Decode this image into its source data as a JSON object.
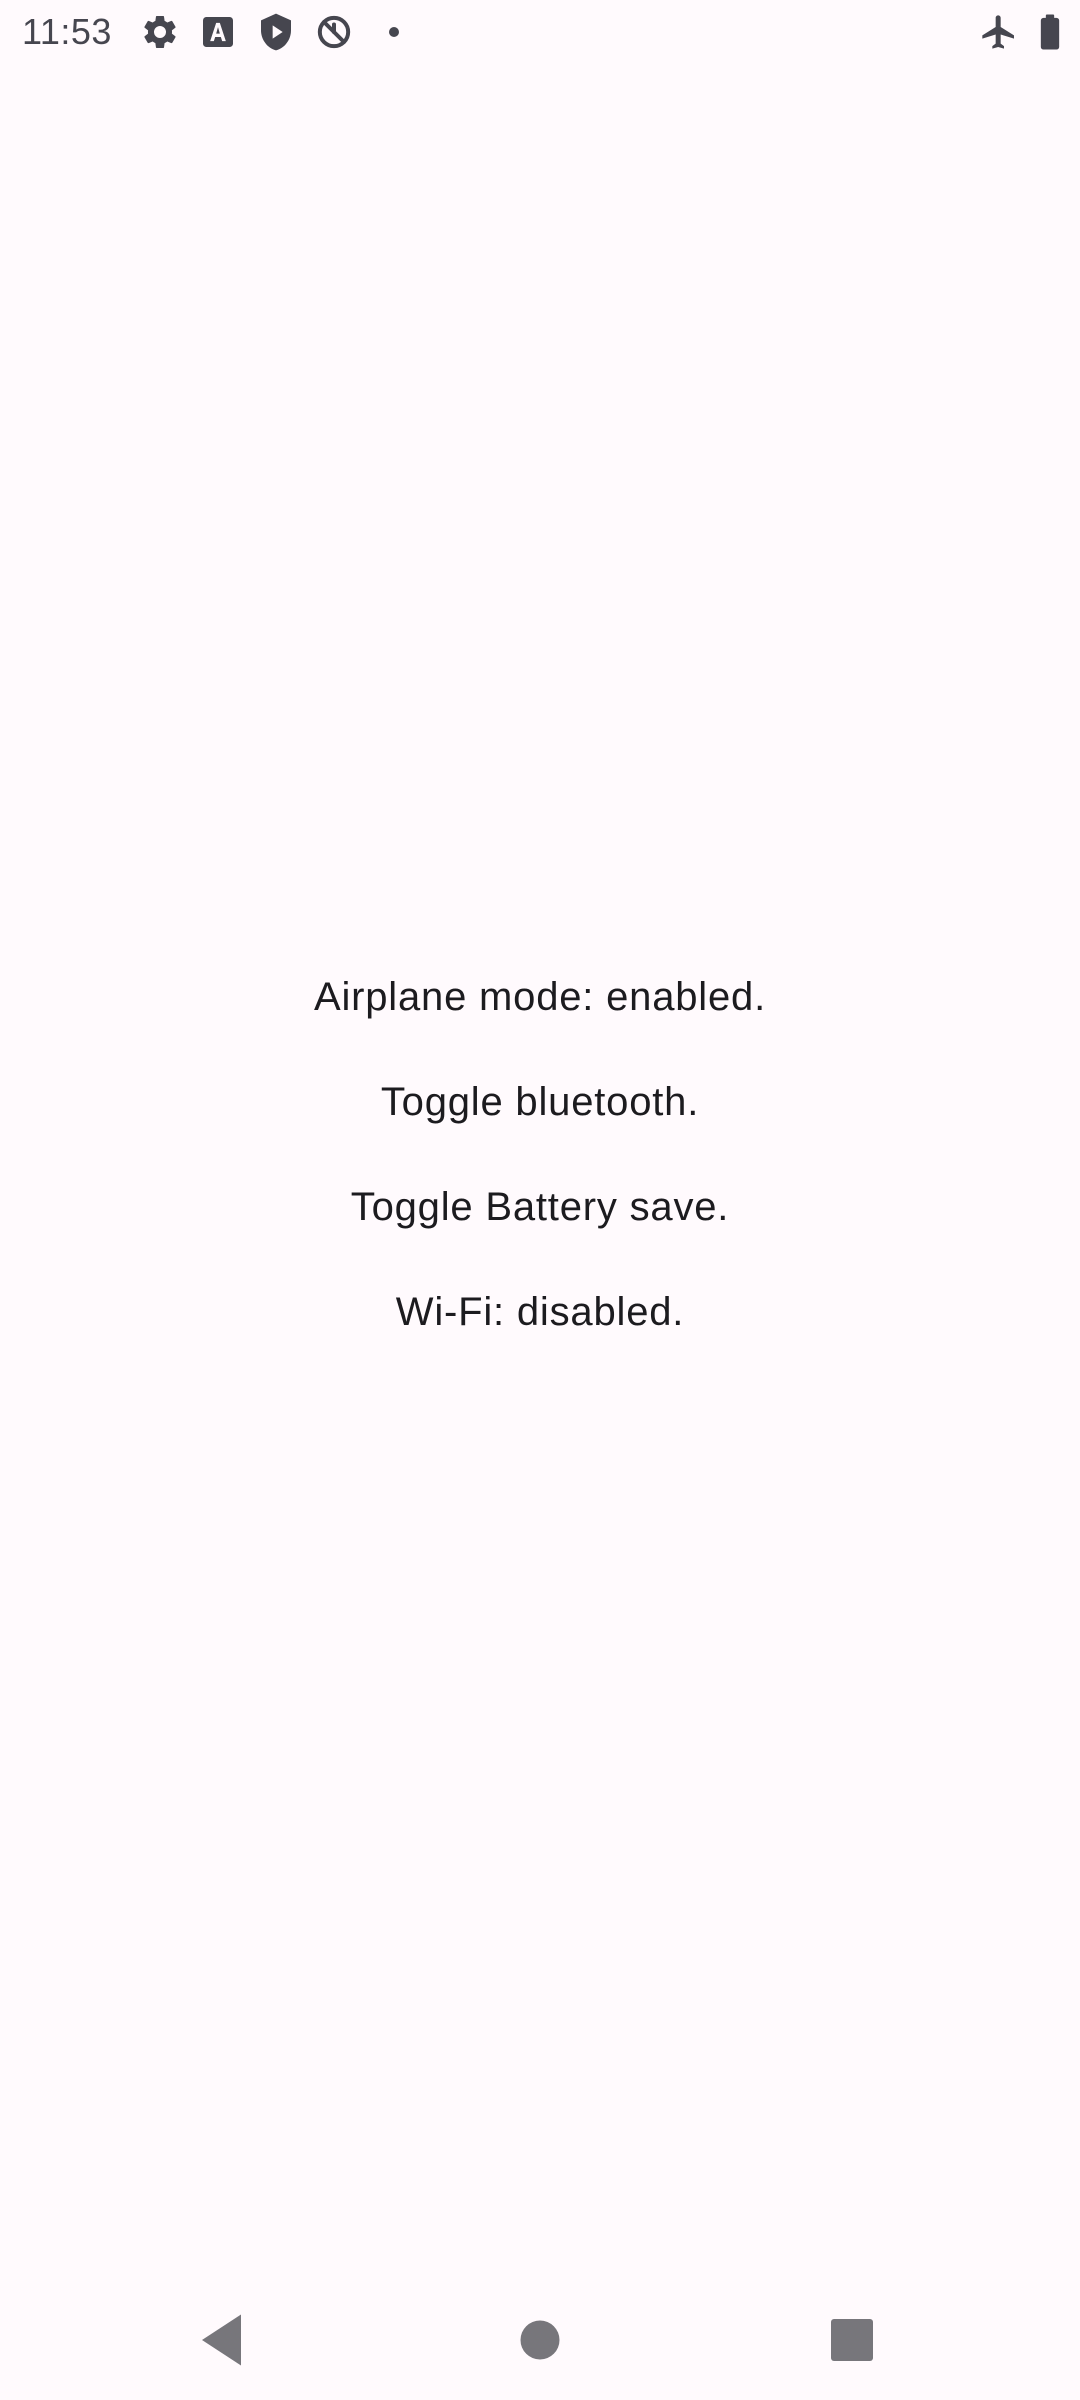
{
  "status_bar": {
    "time": "11:53",
    "left_icons": [
      "settings-icon",
      "text-a-icon",
      "shield-play-icon",
      "sync-off-icon",
      "notification-dot-icon"
    ],
    "right_icons": [
      "airplane-icon",
      "battery-full-icon"
    ]
  },
  "content": {
    "lines": [
      "Airplane mode: enabled.",
      "Toggle bluetooth.",
      "Toggle Battery save.",
      "Wi-Fi: disabled."
    ]
  },
  "nav_bar": {
    "buttons": [
      "back-icon",
      "home-icon",
      "recents-icon"
    ]
  },
  "colors": {
    "background": "#fffafd",
    "text": "#1c1b1f",
    "status_icons": "#46464f",
    "nav_icons": "#77767b"
  }
}
